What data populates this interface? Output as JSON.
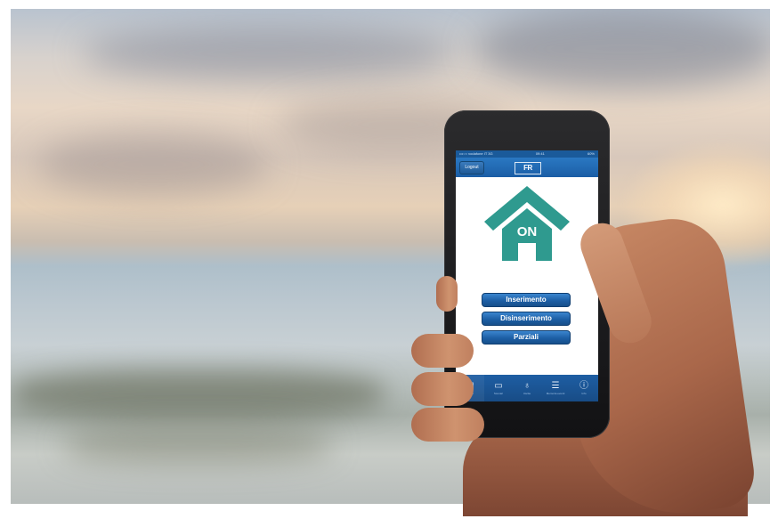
{
  "status_bar": {
    "carrier": "•••○○ vodafone IT 3G",
    "time": "09:41",
    "battery": "60%"
  },
  "header": {
    "logout_label": "Logout",
    "logo_text": "FR"
  },
  "status_indicator": {
    "text": "ON",
    "color": "#2f9a8f"
  },
  "actions": {
    "insert_label": "Inserimento",
    "disarm_label": "Disinserimento",
    "partial_label": "Parziali"
  },
  "tabbar": {
    "items": [
      {
        "icon": "building-icon",
        "label": "Home"
      },
      {
        "icon": "monitor-icon",
        "label": "Scenari"
      },
      {
        "icon": "bulb-icon",
        "label": "Uscite"
      },
      {
        "icon": "list-icon",
        "label": "Memoria eventi"
      },
      {
        "icon": "info-icon",
        "label": "Info"
      }
    ]
  },
  "colors": {
    "accent": "#1d5fa5",
    "house": "#2f9a8f"
  }
}
